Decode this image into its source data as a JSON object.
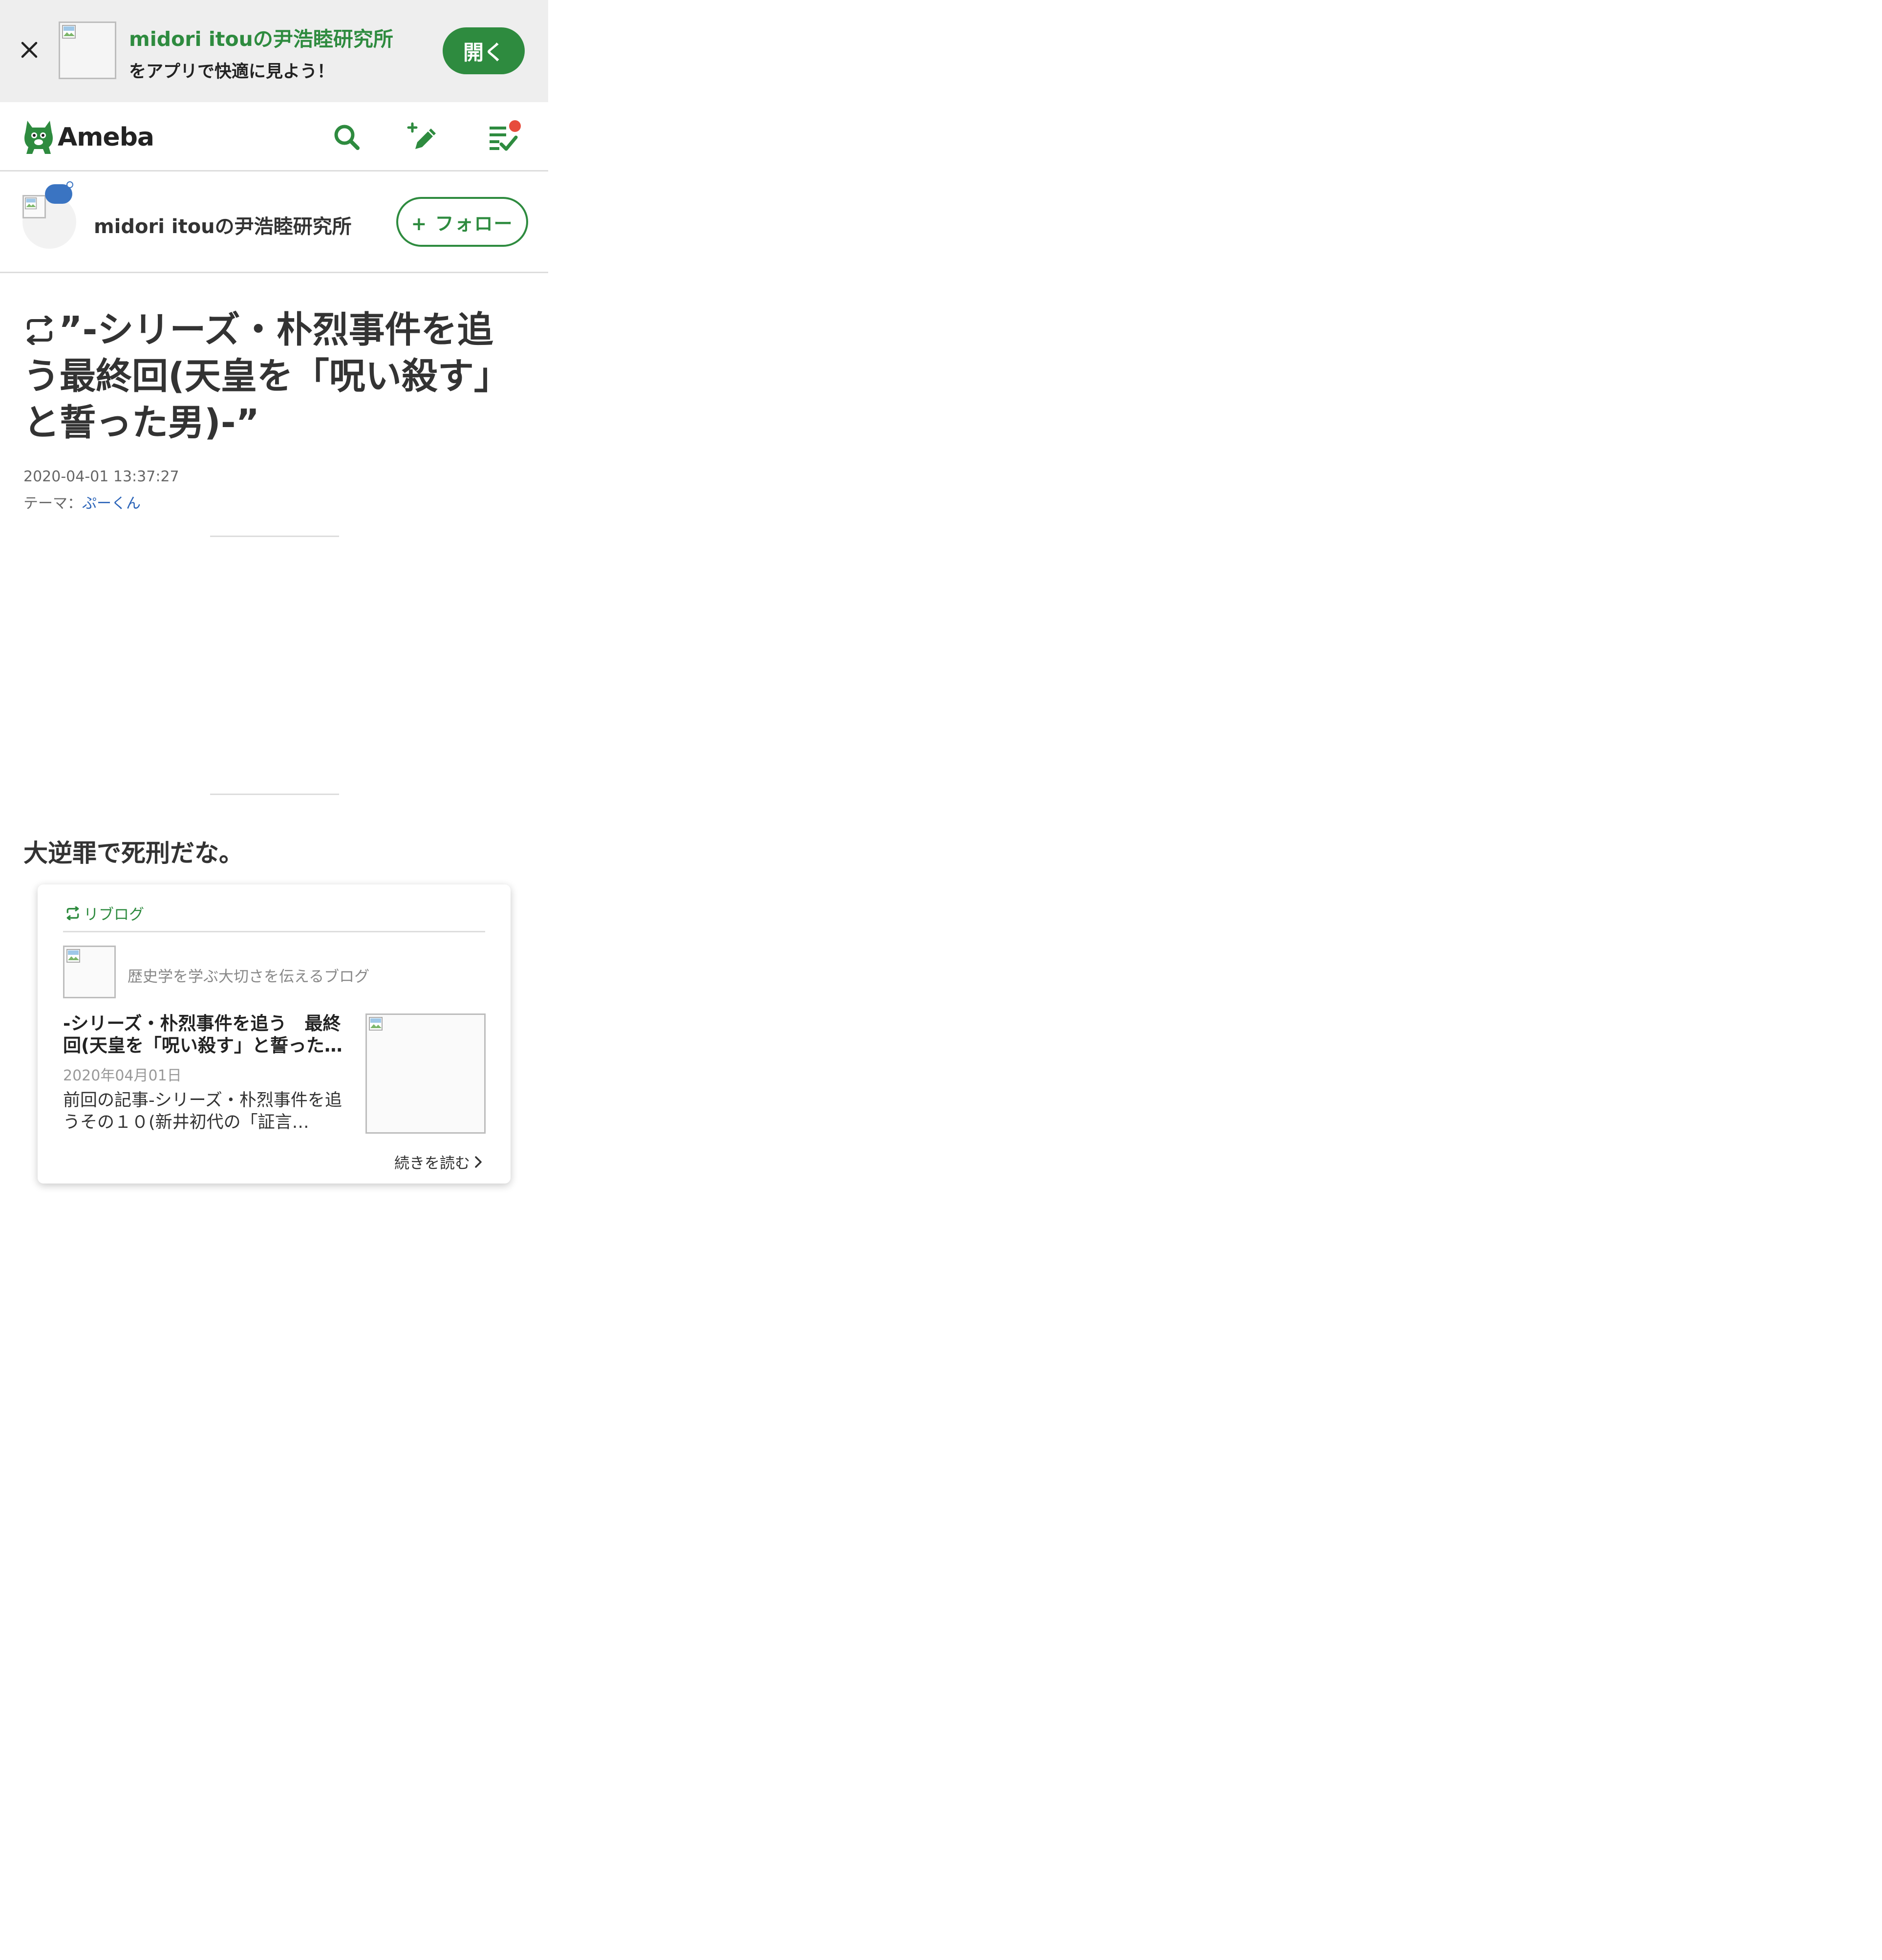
{
  "app_banner": {
    "title": "midori itouの尹浩睦研究所",
    "subtitle": "をアプリで快適に見よう！",
    "open_label": "開く",
    "close_icon": "close-icon"
  },
  "header": {
    "logo_text": "Ameba",
    "icons": [
      "search-icon",
      "write-icon",
      "checklist-icon"
    ],
    "accent_color": "#2e8b3f",
    "notification_color": "#e74c3c"
  },
  "blog": {
    "name": "midori itouの尹浩睦研究所",
    "follow_label": "+ フォロー"
  },
  "article": {
    "title": "”-シリーズ・朴烈事件を追う最終回(天皇を「呪い殺す」と誓った男)-”",
    "date": "2020-04-01 13:37:27",
    "theme_label": "テーマ：",
    "theme_value": "ぷーくん",
    "body_text": "大逆罪で死刑だな。"
  },
  "reblog_card": {
    "label": "リブログ",
    "source_blog": "歴史学を学ぶ大切さを伝えるブログ",
    "title": "-シリーズ・朴烈事件を追う　最終回(天皇を「呪い殺す」と誓った…",
    "date": "2020年04月01日",
    "excerpt": "前回の記事-シリーズ・朴烈事件を追うその１０(新井初代の「証言…",
    "read_more": "続きを読む"
  }
}
